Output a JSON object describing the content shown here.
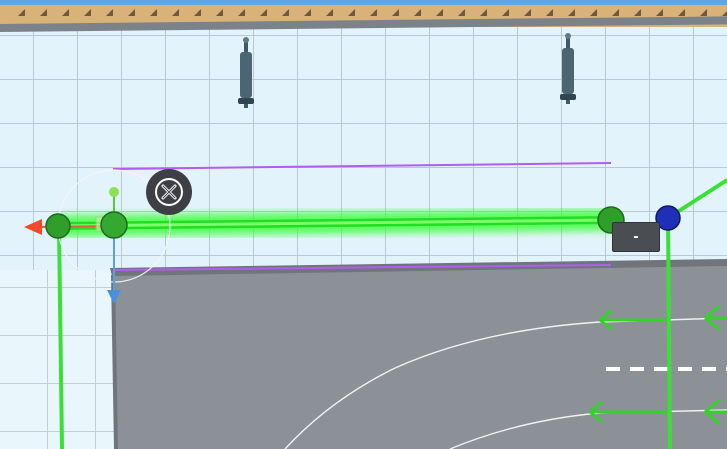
{
  "scene": {
    "name": "street-editor-3d-viewport",
    "colors": {
      "ground": "#e3f3fb",
      "grid_line": "#b7c7d0",
      "road": "#8a9096",
      "wall_top": "#d9b27a",
      "selected_path": "#22e022",
      "guide_line": "#b35cf0",
      "node_green": "#2f9e2a",
      "node_blue": "#1f2fb8",
      "lane_arrow": "#35d12b",
      "lane_mark": "#ffffff",
      "lamp_post": "#3f5a66"
    },
    "lamp_posts": [
      "lamp-post-icon",
      "lamp-post-icon"
    ],
    "gizmo": {
      "axis_x_icon": "arrow-left-red-icon",
      "axis_y_icon": "arrow-up-green-icon",
      "axis_z_icon": "arrow-down-blue-icon"
    }
  },
  "selection_label": {
    "text": "-"
  },
  "controls": {
    "close_icon": "close-icon"
  }
}
